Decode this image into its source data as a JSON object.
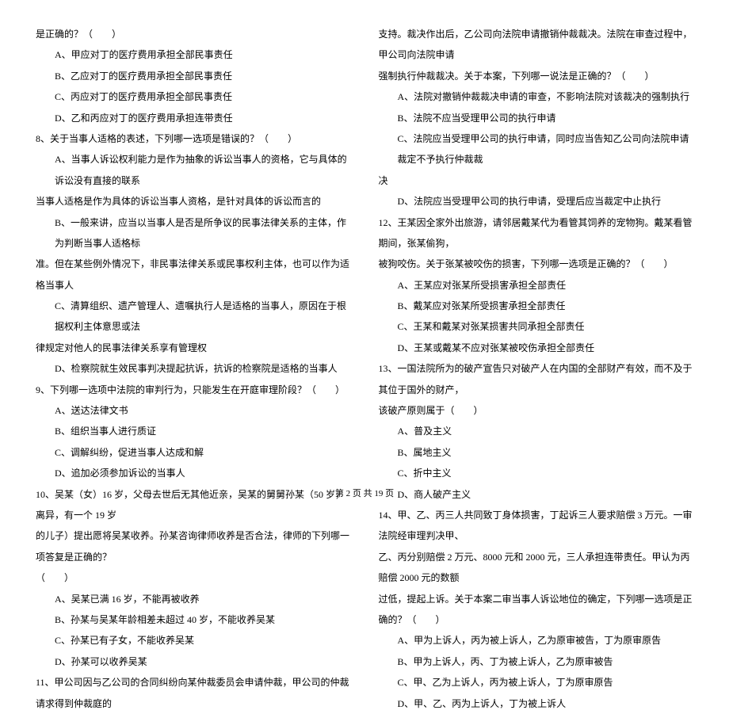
{
  "left_column": [
    {
      "text": "是正确的？（　　）",
      "indent": 0
    },
    {
      "text": "A、甲应对丁的医疗费用承担全部民事责任",
      "indent": 1
    },
    {
      "text": "B、乙应对丁的医疗费用承担全部民事责任",
      "indent": 1
    },
    {
      "text": "C、丙应对丁的医疗费用承担全部民事责任",
      "indent": 1
    },
    {
      "text": "D、乙和丙应对丁的医疗费用承担连带责任",
      "indent": 1
    },
    {
      "text": "8、关于当事人适格的表述，下列哪一选项是错误的？（　　）",
      "indent": 0
    },
    {
      "text": "A、当事人诉讼权利能力是作为抽象的诉讼当事人的资格，它与具体的诉讼没有直接的联系",
      "indent": 1
    },
    {
      "text": "当事人适格是作为具体的诉讼当事人资格，是针对具体的诉讼而言的",
      "indent": 0
    },
    {
      "text": "B、一般来讲，应当以当事人是否是所争议的民事法律关系的主体，作为判断当事人适格标",
      "indent": 1
    },
    {
      "text": "准。但在某些例外情况下，非民事法律关系或民事权利主体，也可以作为适格当事人",
      "indent": 0
    },
    {
      "text": "C、清算组织、遗产管理人、遗嘱执行人是适格的当事人，原因在于根据权利主体意思或法",
      "indent": 1
    },
    {
      "text": "律规定对他人的民事法律关系享有管理权",
      "indent": 0
    },
    {
      "text": "D、检察院就生效民事判决提起抗诉，抗诉的检察院是适格的当事人",
      "indent": 1
    },
    {
      "text": "9、下列哪一选项中法院的审判行为，只能发生在开庭审理阶段？（　　）",
      "indent": 0
    },
    {
      "text": "A、送达法律文书",
      "indent": 1
    },
    {
      "text": "B、组织当事人进行质证",
      "indent": 1
    },
    {
      "text": "C、调解纠纷，促进当事人达成和解",
      "indent": 1
    },
    {
      "text": "D、追加必须参加诉讼的当事人",
      "indent": 1
    },
    {
      "text": "10、吴某（女）16 岁，父母去世后无其他近亲，吴某的舅舅孙某（50 岁，离异，有一个 19 岁",
      "indent": 0
    },
    {
      "text": "的儿子）提出愿将吴某收养。孙某咨询律师收养是否合法，律师的下列哪一项答复是正确的？",
      "indent": 0
    },
    {
      "text": "（　　）",
      "indent": 0
    },
    {
      "text": "A、吴某已满 16 岁，不能再被收养",
      "indent": 1
    },
    {
      "text": "B、孙某与吴某年龄相差未超过 40 岁，不能收养吴某",
      "indent": 1
    },
    {
      "text": "C、孙某已有子女，不能收养吴某",
      "indent": 1
    },
    {
      "text": "D、孙某可以收养吴某",
      "indent": 1
    },
    {
      "text": "11、甲公司因与乙公司的合同纠纷向某仲裁委员会申请仲裁，甲公司的仲裁请求得到仲裁庭的",
      "indent": 0
    }
  ],
  "right_column": [
    {
      "text": "支持。裁决作出后，乙公司向法院申请撤销仲裁裁决。法院在审查过程中，甲公司向法院申请",
      "indent": 0
    },
    {
      "text": "强制执行仲裁裁决。关于本案，下列哪一说法是正确的？（　　）",
      "indent": 0
    },
    {
      "text": "A、法院对撤销仲裁裁决申请的审查，不影响法院对该裁决的强制执行",
      "indent": 1
    },
    {
      "text": "B、法院不应当受理甲公司的执行申请",
      "indent": 1
    },
    {
      "text": "C、法院应当受理甲公司的执行申请，同时应当告知乙公司向法院申请裁定不予执行仲裁裁",
      "indent": 1
    },
    {
      "text": "决",
      "indent": 0
    },
    {
      "text": "D、法院应当受理甲公司的执行申请，受理后应当裁定中止执行",
      "indent": 1
    },
    {
      "text": "12、王某因全家外出旅游，请邻居戴某代为看管其饲养的宠物狗。戴某看管期间，张某偷狗，",
      "indent": 0
    },
    {
      "text": "被狗咬伤。关于张某被咬伤的损害，下列哪一选项是正确的？（　　）",
      "indent": 0
    },
    {
      "text": "A、王某应对张某所受损害承担全部责任",
      "indent": 1
    },
    {
      "text": "B、戴某应对张某所受损害承担全部责任",
      "indent": 1
    },
    {
      "text": "C、王某和戴某对张某损害共同承担全部责任",
      "indent": 1
    },
    {
      "text": "D、王某或戴某不应对张某被咬伤承担全部责任",
      "indent": 1
    },
    {
      "text": "13、一国法院所为的破产宣告只对破产人在内国的全部财产有效，而不及于其位于国外的财产，",
      "indent": 0
    },
    {
      "text": "该破产原则属于（　　）",
      "indent": 0
    },
    {
      "text": "A、普及主义",
      "indent": 1
    },
    {
      "text": "B、属地主义",
      "indent": 1
    },
    {
      "text": "C、折中主义",
      "indent": 1
    },
    {
      "text": "D、商人破产主义",
      "indent": 1
    },
    {
      "text": "14、甲、乙、丙三人共同致丁身体损害，丁起诉三人要求赔偿 3 万元。一审法院经审理判决甲、",
      "indent": 0
    },
    {
      "text": "乙、丙分别赔偿 2 万元、8000 元和 2000 元，三人承担连带责任。甲认为丙赔偿 2000 元的数额",
      "indent": 0
    },
    {
      "text": "过低，提起上诉。关于本案二审当事人诉讼地位的确定，下列哪一选项是正确的？（　　）",
      "indent": 0
    },
    {
      "text": "A、甲为上诉人，丙为被上诉人，乙为原审被告，丁为原审原告",
      "indent": 1
    },
    {
      "text": "B、甲为上诉人，丙、丁为被上诉人，乙为原审被告",
      "indent": 1
    },
    {
      "text": "C、甲、乙为上诉人，丙为被上诉人，丁为原审原告",
      "indent": 1
    },
    {
      "text": "D、甲、乙、丙为上诉人，丁为被上诉人",
      "indent": 1
    }
  ],
  "footer": "第 2 页 共 19 页"
}
